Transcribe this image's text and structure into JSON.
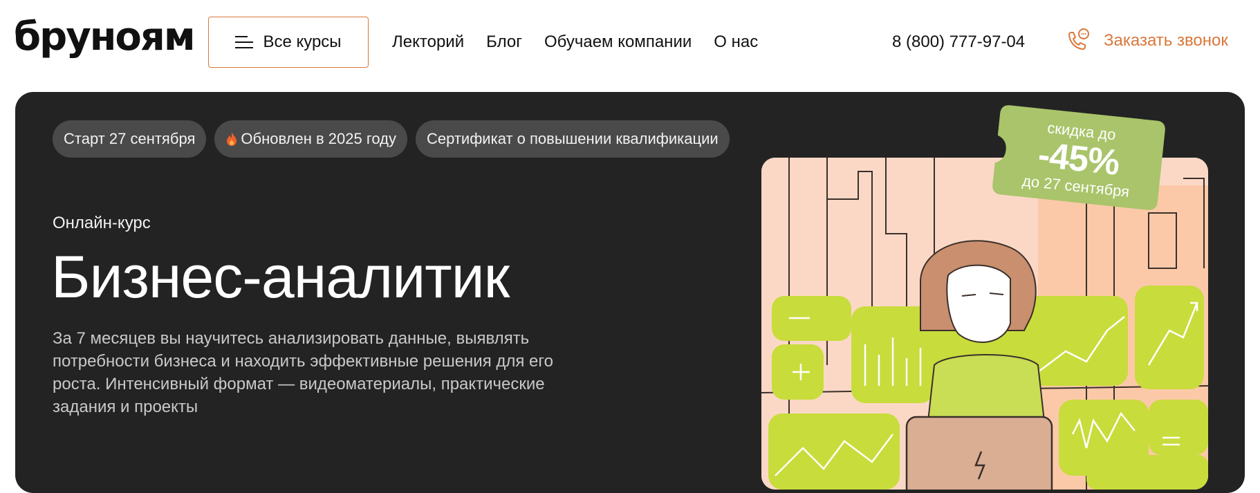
{
  "header": {
    "logo": "бруноям",
    "all_courses_label": "Все курсы",
    "nav": [
      "Лекторий",
      "Блог",
      "Обучаем компании",
      "О нас"
    ],
    "phone": "8 (800) 777-97-04",
    "callback_label": "Заказать звонок"
  },
  "hero": {
    "chips": [
      "Старт 27 сентября",
      "Обновлен в 2025 году",
      "Сертификат о повышении квалификации"
    ],
    "eyebrow": "Онлайн-курс",
    "title": "Бизнес-аналитик",
    "lead": "За 7 месяцев вы научитесь анализировать данные, выявлять потребности бизнеса и находить эффективные решения для его роста. Интенсивный формат — видеоматериалы, практические задания и проекты",
    "badge": {
      "top": "скидка до",
      "percent": "-45%",
      "bottom": "до 27 сентября"
    }
  },
  "colors": {
    "accent": "#d9773a",
    "hero_bg": "#232323",
    "chip_bg": "#4a4a4a",
    "badge_green": "#a9c46a",
    "illustration_lime": "#c8dc3c",
    "illustration_peach": "#fbd8c6"
  },
  "icons": {
    "menu": "burger-menu-icon",
    "phone": "phone-chat-icon",
    "fire": "fire-icon"
  }
}
